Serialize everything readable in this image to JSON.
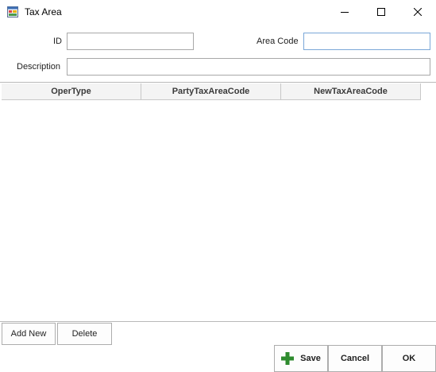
{
  "window": {
    "title": "Tax Area"
  },
  "form": {
    "id_label": "ID",
    "id_value": "",
    "area_code_label": "Area Code",
    "area_code_value": "",
    "description_label": "Description",
    "description_value": ""
  },
  "grid": {
    "columns": [
      "OperType",
      "PartyTaxAreaCode",
      "NewTaxAreaCode"
    ],
    "rows": []
  },
  "grid_buttons": {
    "add_new": "Add New",
    "delete": "Delete"
  },
  "footer": {
    "save": "Save",
    "cancel": "Cancel",
    "ok": "OK"
  },
  "colors": {
    "plus_icon": "#2e8b2e",
    "focus_border": "#7aa7d8"
  },
  "icons": {
    "app": "form-window-icon",
    "minimize": "minimize-icon",
    "maximize": "maximize-icon",
    "close": "close-icon",
    "save": "plus-icon"
  }
}
